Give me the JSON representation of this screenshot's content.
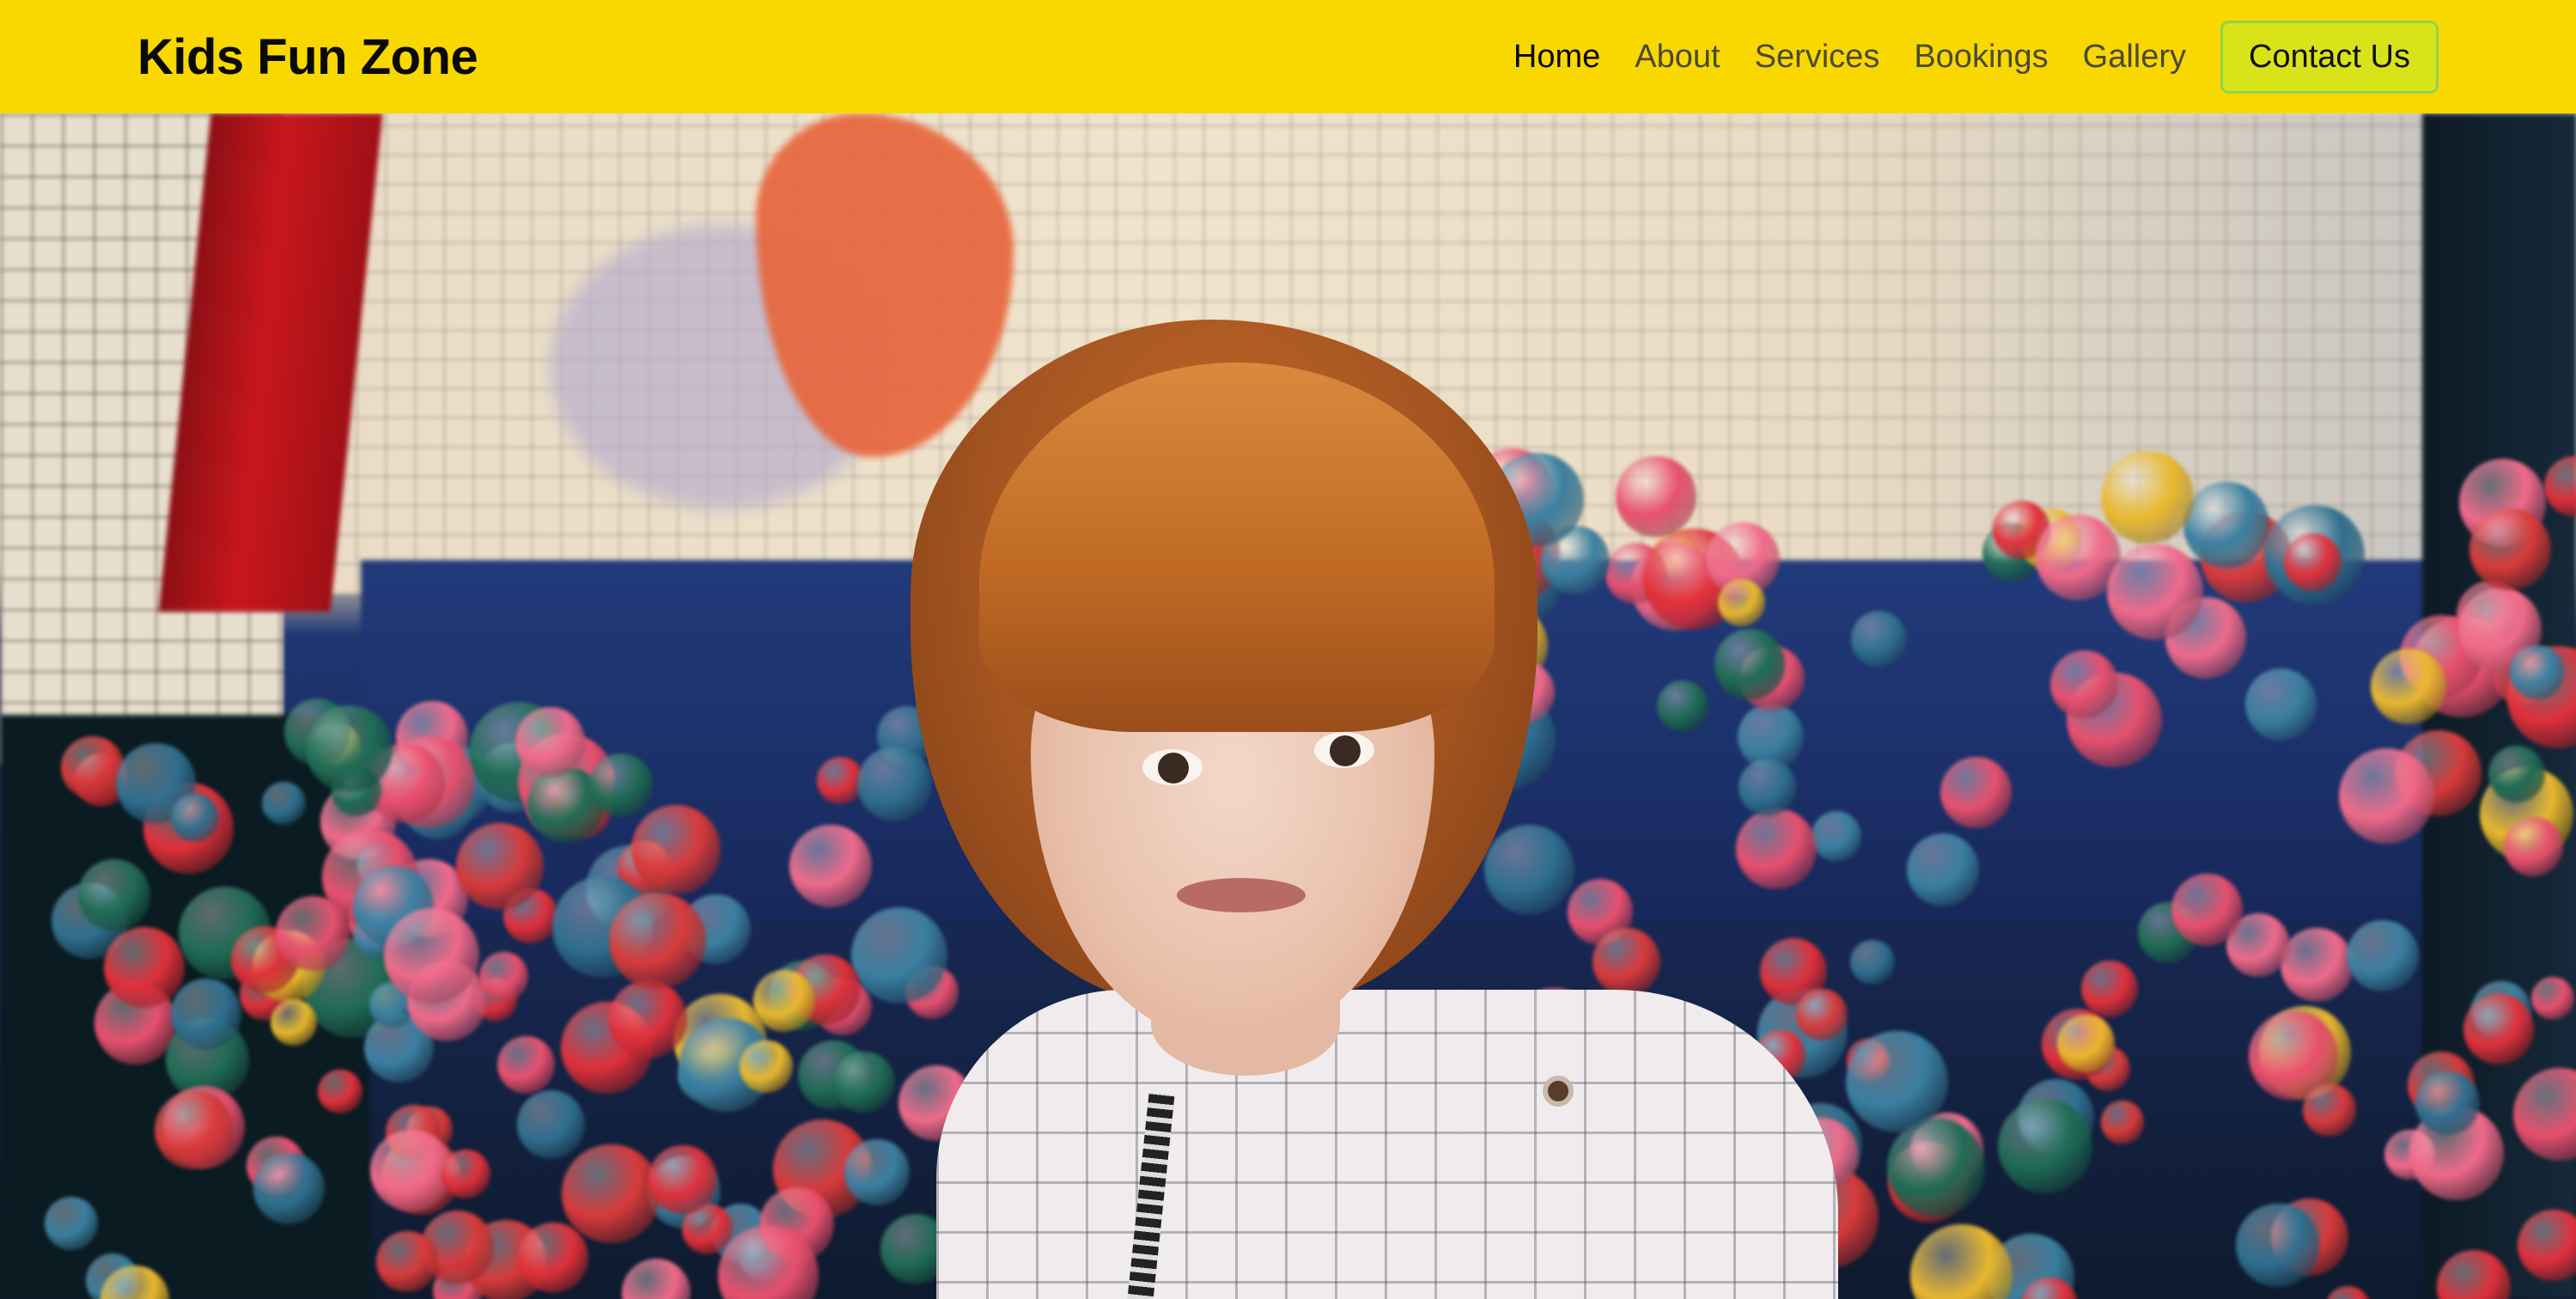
{
  "header": {
    "brand": "Kids Fun Zone",
    "nav": [
      {
        "label": "Home",
        "active": true
      },
      {
        "label": "About",
        "active": false
      },
      {
        "label": "Services",
        "active": false
      },
      {
        "label": "Bookings",
        "active": false
      },
      {
        "label": "Gallery",
        "active": false
      }
    ],
    "contact_label": "Contact Us"
  },
  "hero": {
    "image": "photo-child-in-ball-pit"
  },
  "colors": {
    "navbar_bg": "#f8d800",
    "contact_bg": "#d9e31a",
    "contact_border": "#8fd34b"
  }
}
